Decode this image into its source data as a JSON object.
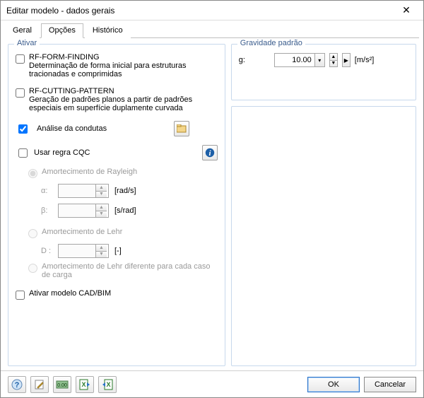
{
  "window": {
    "title": "Editar modelo - dados gerais"
  },
  "tabs": [
    {
      "label": "Geral"
    },
    {
      "label": "Opções"
    },
    {
      "label": "Histórico"
    }
  ],
  "activate": {
    "legend": "Ativar",
    "form_finding": {
      "title": "RF-FORM-FINDING",
      "desc": "Determinação de forma inicial para estruturas tracionadas e comprimidas",
      "checked": false
    },
    "cutting_pattern": {
      "title": "RF-CUTTING-PATTERN",
      "desc": "Geração de padrões planos a partir de padrões especiais em superfície duplamente curvada",
      "checked": false
    },
    "analysis_pipes": {
      "label": "Análise da condutas",
      "checked": true
    },
    "cqc": {
      "label": "Usar regra CQC",
      "checked": false
    },
    "damping": {
      "rayleigh": {
        "label": "Amortecimento de Rayleigh"
      },
      "alpha": {
        "label": "α:",
        "value": "",
        "unit": "[rad/s]"
      },
      "beta": {
        "label": "β:",
        "value": "",
        "unit": "[s/rad]"
      },
      "lehr": {
        "label": "Amortecimento de Lehr"
      },
      "d": {
        "label": "D :",
        "value": "",
        "unit": "[-]"
      },
      "lehr_per_case": {
        "label": "Amortecimento de Lehr diferente para cada caso de carga"
      }
    },
    "cadbim": {
      "label": "Ativar modelo CAD/BIM",
      "checked": false
    }
  },
  "gravity": {
    "legend": "Gravidade padrão",
    "label": "g:",
    "value": "10.00",
    "unit": "[m/s²]"
  },
  "buttons": {
    "ok": "OK",
    "cancel": "Cancelar"
  },
  "toolbar_icons": {
    "help": "help-icon",
    "edit": "edit-icon",
    "units": "units-icon",
    "excel_export": "excel-export-icon",
    "excel_import": "excel-import-icon"
  }
}
